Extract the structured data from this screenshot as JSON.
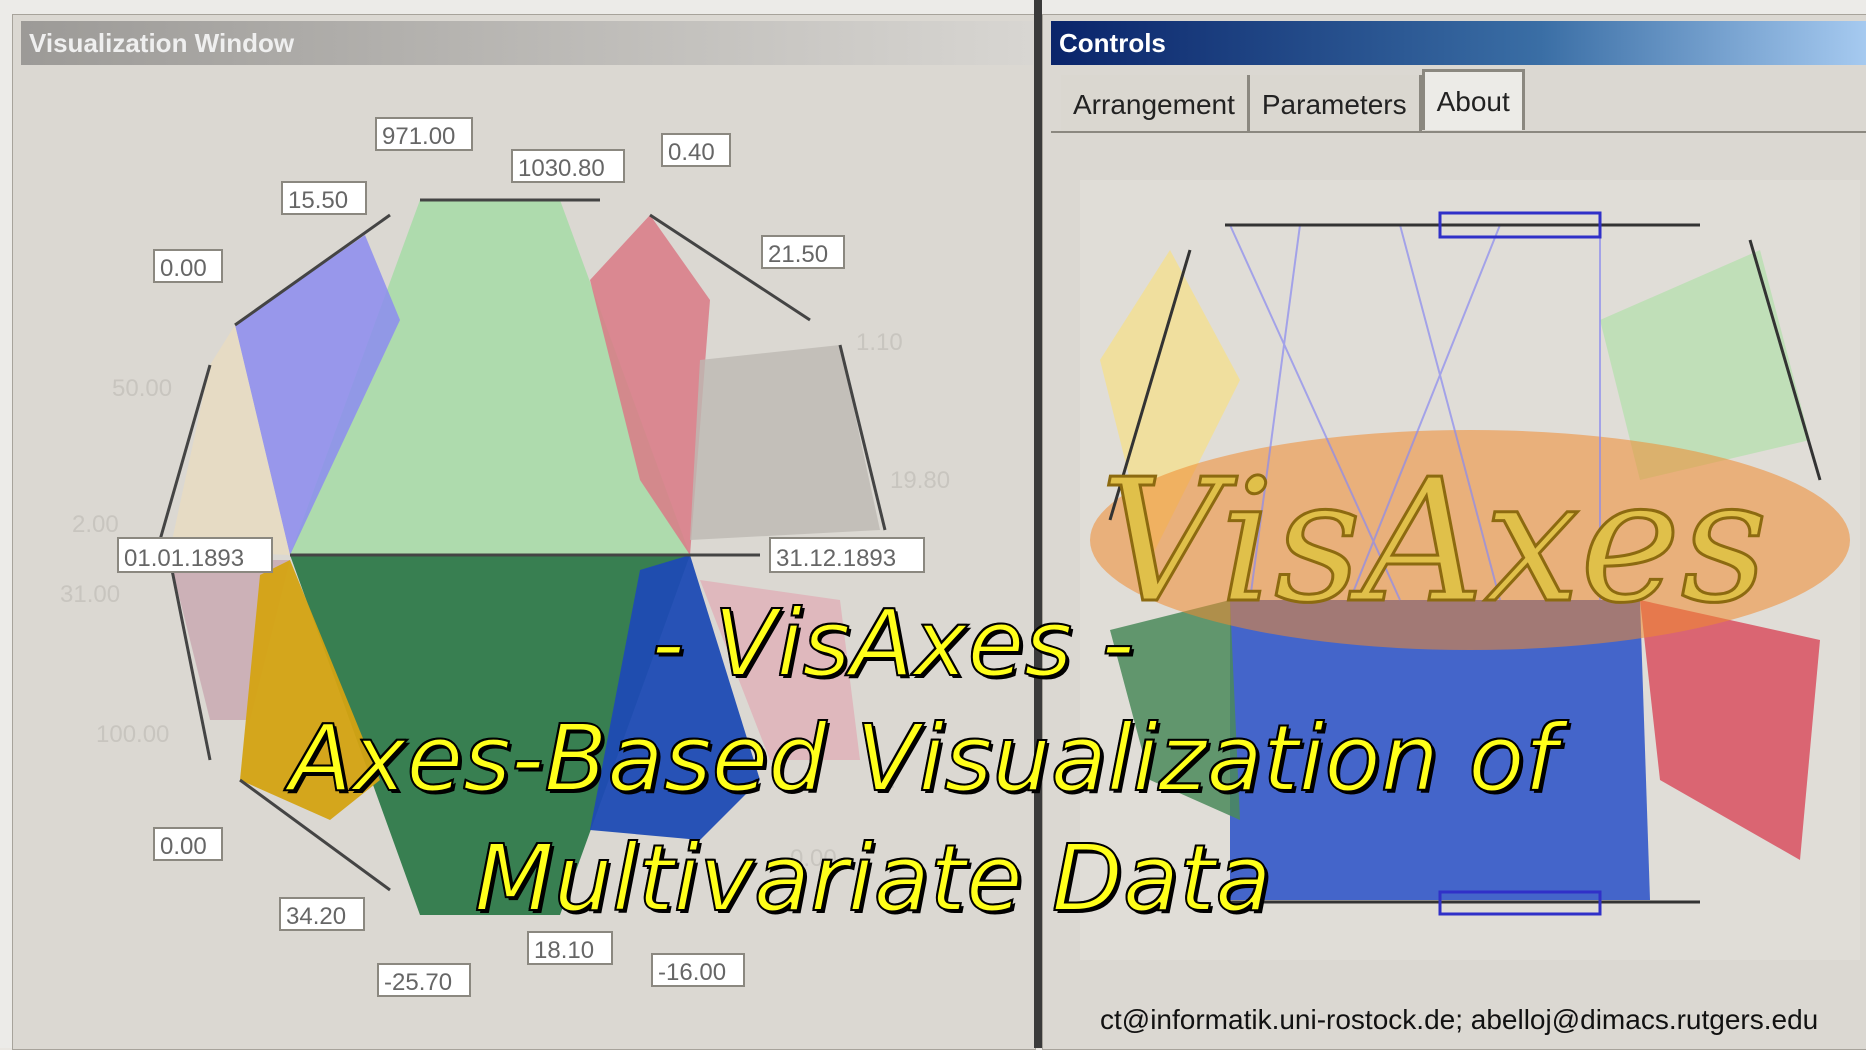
{
  "visualization_window": {
    "title": "Visualization Window",
    "axis_labels": [
      "971.00",
      "1030.80",
      "0.40",
      "15.50",
      "0.00",
      "21.50",
      "1.10",
      "50.00",
      "19.80",
      "2.00",
      "01.01.1893",
      "31.12.1893",
      "31.00",
      "100.00",
      "0.00",
      "34.20",
      "-25.70",
      "18.10",
      "-16.00",
      "9.",
      "0.00"
    ]
  },
  "controls": {
    "title": "Controls",
    "tabs": [
      {
        "label": "Arrangement",
        "active": false
      },
      {
        "label": "Parameters",
        "active": false
      },
      {
        "label": "About",
        "active": true
      }
    ],
    "logo": "VisAxes",
    "contact": "ct@informatik.uni-rostock.de;  abelloj@dimacs.rutgers.edu"
  },
  "overlay": {
    "line1": "- VisAxes -",
    "line2": "Axes-Based Visualization of",
    "line3": "Multivariate Data"
  },
  "colors": {
    "overlay_text": "#ffff1a",
    "controls_title_bar": "#0a246a",
    "green_light": "#a8dca8",
    "green_dark": "#2f7a4a",
    "purple": "#8c8cf0",
    "pink": "#d97a86",
    "blue": "#1e4bb4",
    "gold": "#d4a312"
  }
}
